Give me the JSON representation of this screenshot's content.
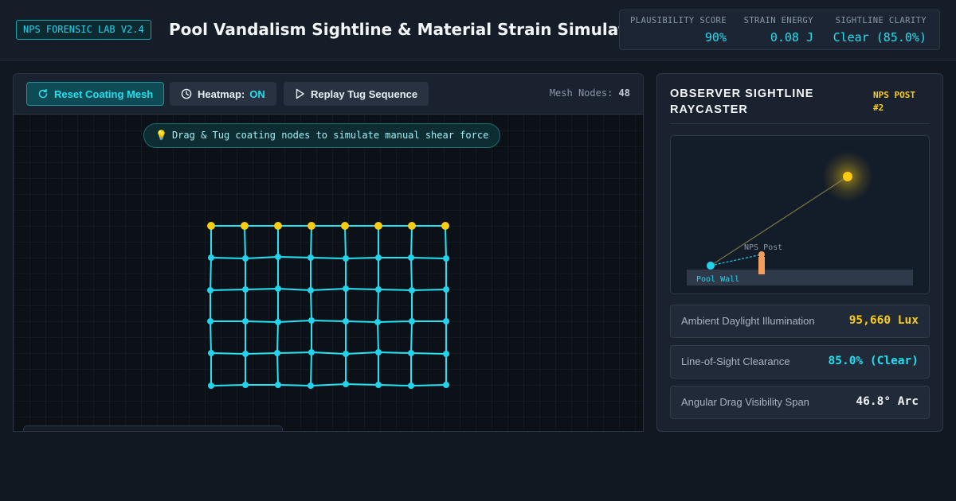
{
  "header": {
    "badge": "NPS FORENSIC LAB V2.4",
    "title": "Pool Vandalism Sightline & Material Strain Simulator",
    "stats": [
      {
        "label": "PLAUSIBILITY SCORE",
        "value": "90%"
      },
      {
        "label": "STRAIN ENERGY",
        "value": "0.08 J"
      },
      {
        "label": "SIGHTLINE CLARITY",
        "value": "Clear (85.0%)"
      }
    ]
  },
  "toolbar": {
    "reset_label": "Reset Coating Mesh",
    "reset_icon": "refresh-icon",
    "heatmap_label": "Heatmap:",
    "heatmap_state": "ON",
    "heatmap_icon": "clock-icon",
    "replay_label": "Replay Tug Sequence",
    "replay_icon": "play-icon",
    "mesh_nodes_label": "Mesh Nodes:",
    "mesh_nodes_value": "48"
  },
  "canvas": {
    "hint_icon": "lightbulb-icon",
    "hint": "Drag & Tug coating nodes to simulate manual shear force",
    "mesh": {
      "cols": 8,
      "rows": 6,
      "anchor_color": "#facc15",
      "node_color": "#22d3ee",
      "edge_color": "#22e5f5"
    }
  },
  "sightline": {
    "title": "OBSERVER SIGHTLINE RAYCASTER",
    "tag": "NPS POST #2",
    "scene": {
      "post_label": "NPS Post",
      "wall_label": "Pool Wall",
      "sun_color": "#facc15",
      "post_color": "#f59e5b",
      "observer_color": "#22d3ee"
    },
    "metrics": [
      {
        "label": "Ambient Daylight Illumination",
        "value": "95,660 Lux",
        "color": "#facc15"
      },
      {
        "label": "Line-of-Sight Clearance",
        "value": "85.0% (Clear)",
        "color": "#22e0f0"
      },
      {
        "label": "Angular Drag Visibility Span",
        "value": "46.8° Arc",
        "color": "#f3f6f9"
      }
    ]
  }
}
